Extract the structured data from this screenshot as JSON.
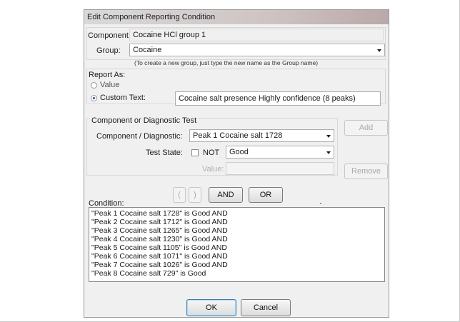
{
  "dialog": {
    "title": "Edit Component Reporting Condition",
    "component_label": "Component:",
    "component_value": "Cocaine HCl group 1",
    "group_label": "Group:",
    "group_value": "Cocaine",
    "group_hint": "(To create a new group, just type the new name as the Group name)"
  },
  "report_as": {
    "label": "Report As:",
    "value_option": "Value",
    "custom_option": "Custom Text:",
    "custom_text": "Cocaine salt presence Highly confidence (8 peaks)",
    "selected": "Custom Text"
  },
  "diagnostic": {
    "section_label": "Component or Diagnostic Test",
    "component_label": "Component / Diagnostic:",
    "component_value": "Peak 1 Cocaine salt 1728",
    "test_state_label": "Test State:",
    "not_label": "NOT",
    "not_checked": false,
    "state_value": "Good",
    "value_label": "Value:",
    "value_value": "",
    "add_button": "Add",
    "remove_button": "Remove"
  },
  "condition": {
    "label": "Condition:",
    "open_paren": "(",
    "close_paren": ")",
    "and_button": "AND",
    "or_button": "OR",
    "lines": [
      "\"Peak 1 Cocaine salt 1728\" is Good AND",
      "\"Peak 2 Cocaine salt 1712\" is Good AND",
      "\"Peak 3 Cocaine salt 1265\" is Good AND",
      "\"Peak 4 Cocaine salt 1230\" is Good AND",
      "\"Peak 5 Cocaine salt 1105\" is Good AND",
      "\"Peak 6 Cocaine salt 1071\" is Good AND",
      "\"Peak 7 Cocaine salt 1026\" is Good AND",
      "\"Peak 8 Cocaine salt 729\" is Good"
    ]
  },
  "footer": {
    "ok_button": "OK",
    "cancel_button": "Cancel"
  }
}
